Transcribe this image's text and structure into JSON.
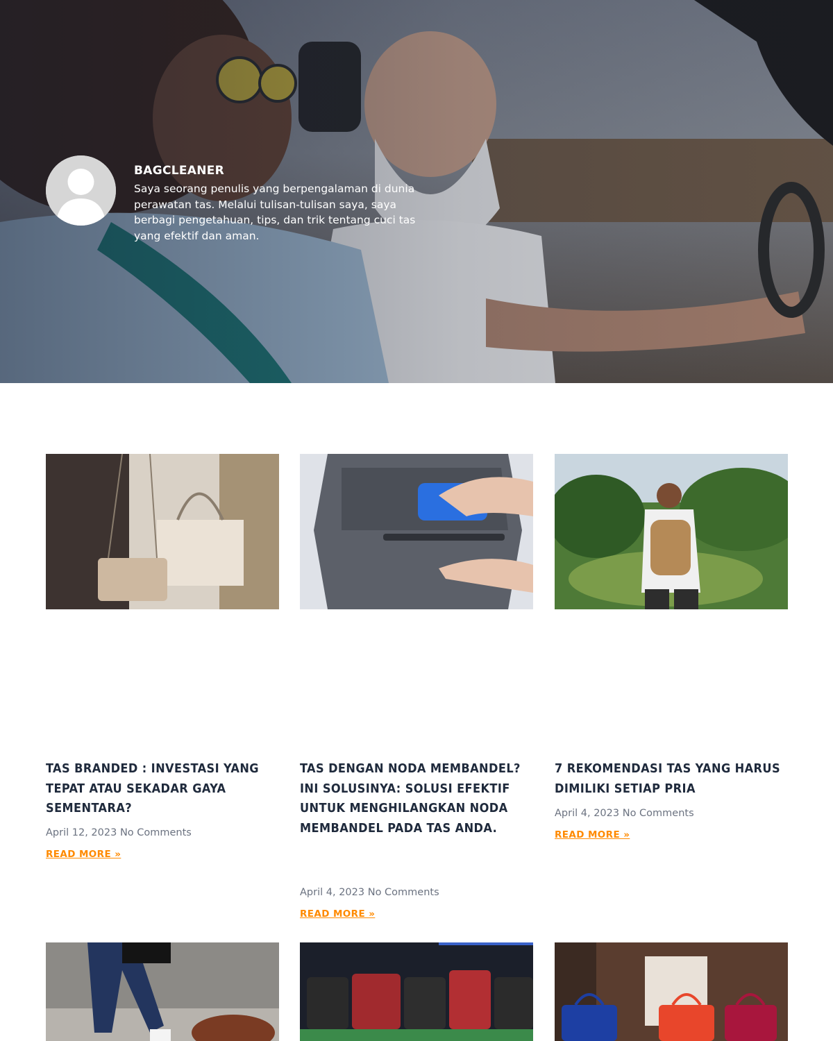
{
  "author": {
    "name": "BAGCLEANER",
    "bio": "Saya seorang penulis yang berpengalaman di dunia perawatan tas. Melalui tulisan-tulisan saya, saya berbagi pengetahuan, tips, dan trik tentang cuci tas yang efektif dan aman.",
    "avatar_icon": "default-user-icon"
  },
  "posts": [
    {
      "title": "TAS BRANDED : INVESTASI YANG TEPAT ATAU SEKADAR GAYA SEMENTARA?",
      "date": "April 12, 2023",
      "comments": "No Comments",
      "read_more": "READ MORE »"
    },
    {
      "title": "TAS DENGAN NODA MEMBANDEL? INI SOLUSINYA: SOLUSI EFEKTIF UNTUK MENGHILANGKAN NODA MEMBANDEL PADA TAS ANDA.",
      "date": "April 4, 2023",
      "comments": "No Comments",
      "read_more": "READ MORE »"
    },
    {
      "title": "7 REKOMENDASI TAS YANG HARUS DIMILIKI SETIAP PRIA",
      "date": "April 4, 2023",
      "comments": "No Comments",
      "read_more": "READ MORE »"
    }
  ],
  "colors": {
    "accent": "#ff8a00",
    "title": "#1f2a3c",
    "meta": "#6b7280"
  }
}
